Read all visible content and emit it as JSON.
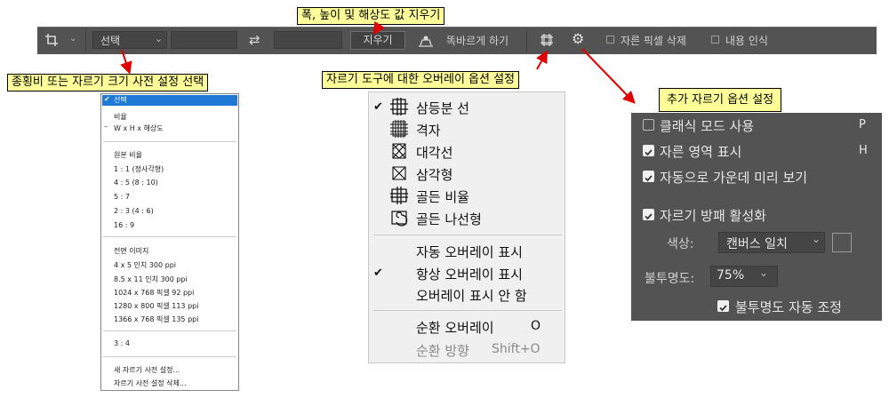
{
  "options_bar": {
    "preset_value": "선택",
    "clear_label": "지우기",
    "straighten_label": "똑바르게 하기",
    "delete_cropped_label": "자른 픽셀 삭제",
    "content_aware_label": "내용 인식"
  },
  "callouts": {
    "clear_values": "폭, 높이 및 해상도 값 지우기",
    "ratio_preset": "종횡비 또는 자르기 크기 사전 설정 선택",
    "overlay_options": "자르기 도구에 대한 오버레이 옵션 설정",
    "additional_options": "추가 자르기 옵션 설정"
  },
  "preset_menu": {
    "items": {
      "select": "선택",
      "ratio": "비율",
      "whr": "W x H x 해상도",
      "original_ratio": "원본 비율",
      "r1_1": "1 : 1 (정사각형)",
      "r4_5": "4 : 5 (8 : 10)",
      "r5_7": "5 : 7",
      "r2_3": "2 : 3 (4 : 6)",
      "r16_9": "16 : 9",
      "front_image": "전면 이미지",
      "s4x5": "4 x 5 인치 300 ppi",
      "s85x11": "8.5 x 11 인치 300 ppi",
      "s1024": "1024 x 768 픽셀 92 ppi",
      "s1280": "1280 x 800 픽셀 113 ppi",
      "s1366": "1366 x 768 픽셀 135 ppi",
      "r3_4": "3 : 4",
      "new_preset": "새 자르기 사전 설정...",
      "delete_preset": "자르기 사전 설정 삭제..."
    }
  },
  "overlay_menu": {
    "items": {
      "thirds": "삼등분 선",
      "grid": "격자",
      "diagonal": "대각선",
      "triangle": "삼각형",
      "golden_ratio": "골든 비율",
      "golden_spiral": "골든 나선형",
      "auto_show": "자동 오버레이 표시",
      "always_show": "항상 오버레이 표시",
      "never_show": "오버레이 표시 안 함",
      "cycle": "순환 오버레이",
      "cycle_key": "O",
      "cycle_orientation": "순환 방향",
      "cycle_orientation_key": "Shift+O"
    }
  },
  "crop_panel": {
    "classic_mode": "클래식 모드 사용",
    "classic_key": "P",
    "show_cropped": "자른 영역 표시",
    "show_cropped_key": "H",
    "auto_center": "자동으로 가운데 미리 보기",
    "enable_shield": "자르기 방패 활성화",
    "color_label": "색상:",
    "color_value": "캔버스 일치",
    "opacity_label": "불투명도:",
    "opacity_value": "75%",
    "auto_adjust_opacity": "불투명도 자동 조정"
  },
  "colors": {
    "callout_bg": "#ffff99",
    "arrow": "#e00000",
    "panel_bg": "#535353",
    "selected": "#1e7ad6"
  }
}
